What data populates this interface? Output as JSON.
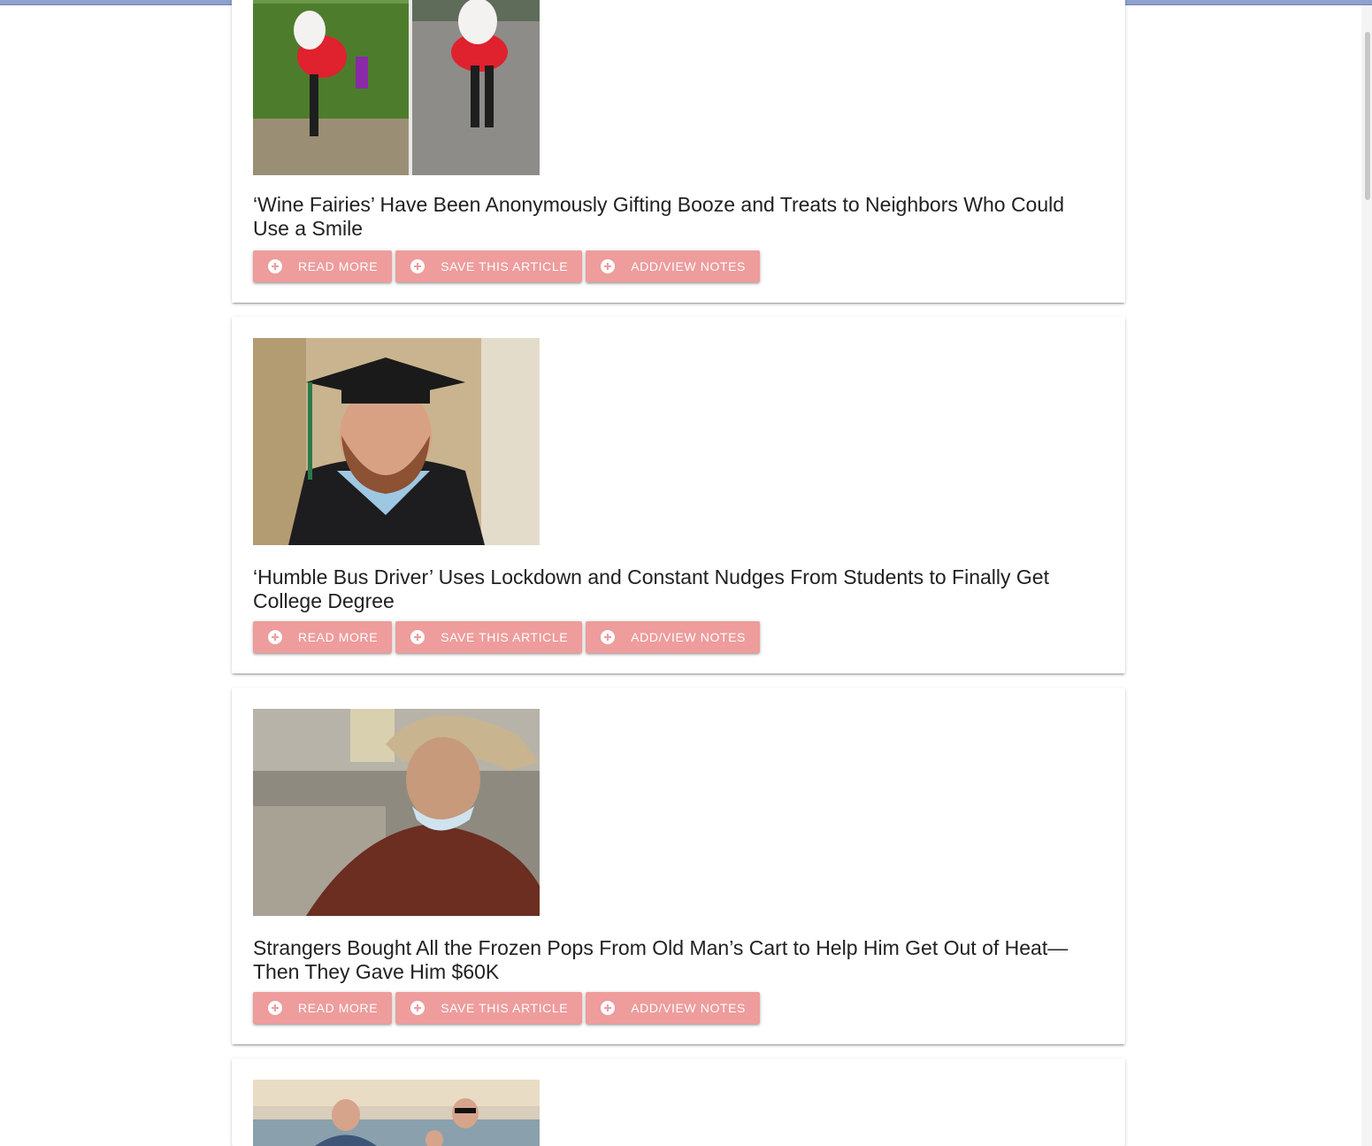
{
  "colors": {
    "accent": "#ee9c9c",
    "topbar": "#8fa1cf"
  },
  "button_icon": "add-circle-icon",
  "articles": [
    {
      "title": "‘Wine Fairies’ Have Been Anonymously Gifting Booze and Treats to Neighbors Who Could Use a Smile",
      "read_more": "READ MORE",
      "save": "SAVE THIS ARTICLE",
      "notes": "ADD/VIEW NOTES"
    },
    {
      "title": "‘Humble Bus Driver’ Uses Lockdown and Constant Nudges From Students to Finally Get College Degree",
      "read_more": "READ MORE",
      "save": "SAVE THIS ARTICLE",
      "notes": "ADD/VIEW NOTES"
    },
    {
      "title": "Strangers Bought All the Frozen Pops From Old Man’s Cart to Help Him Get Out of Heat—Then They Gave Him $60K",
      "read_more": "READ MORE",
      "save": "SAVE THIS ARTICLE",
      "notes": "ADD/VIEW NOTES"
    }
  ]
}
